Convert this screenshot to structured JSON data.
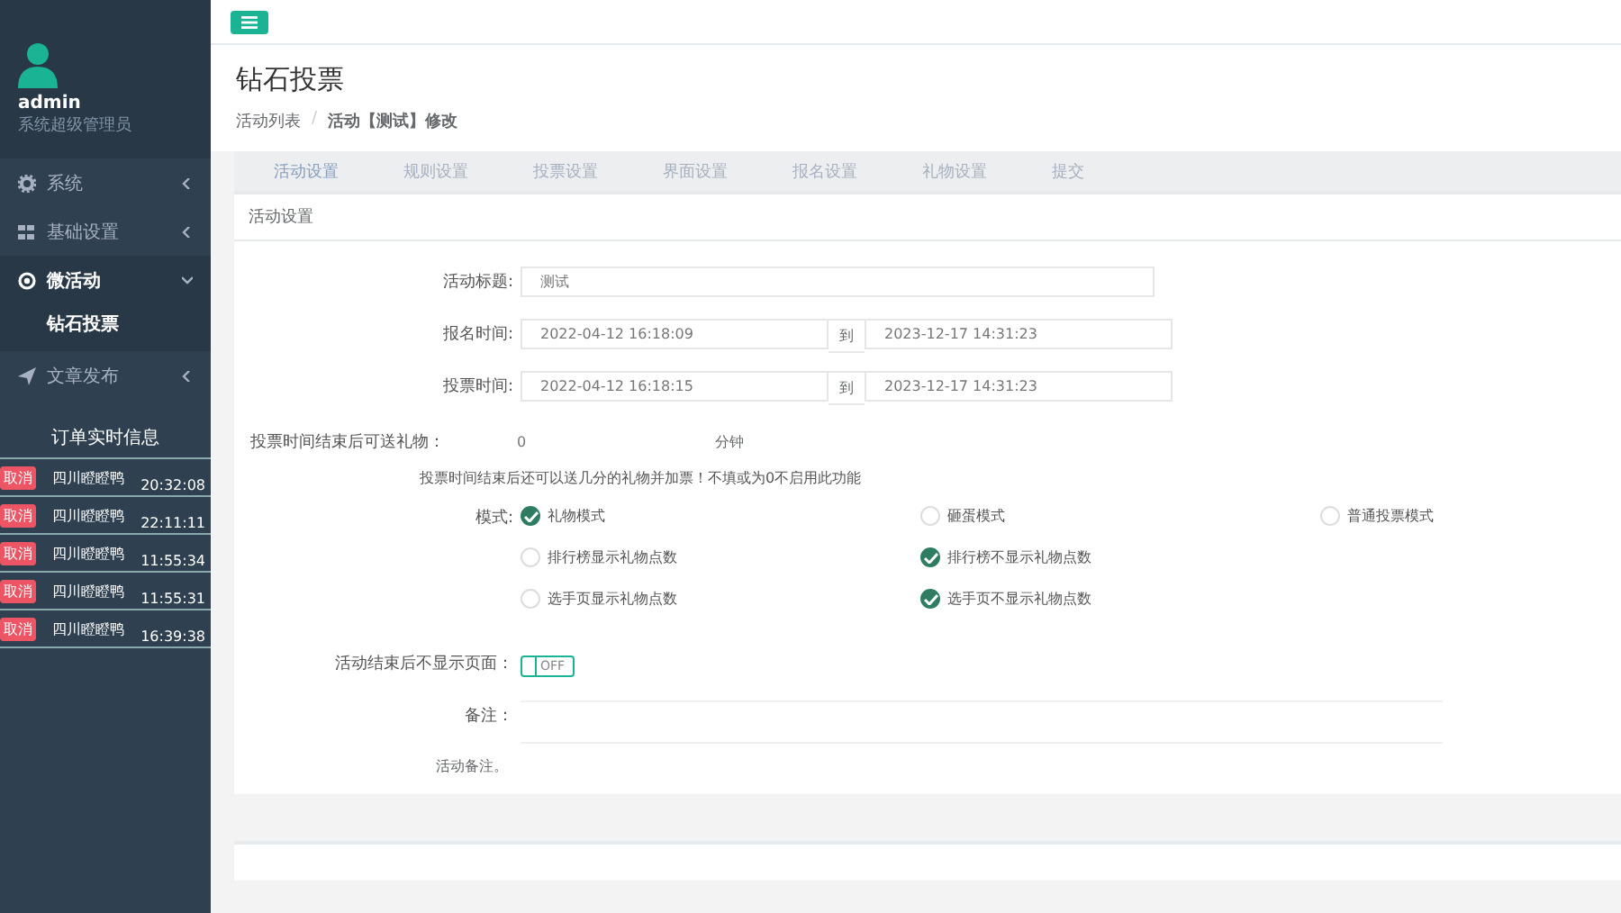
{
  "sidebar": {
    "user": {
      "name": "admin",
      "role": "系统超级管理员"
    },
    "menu": [
      {
        "label": "系统",
        "expanded": false
      },
      {
        "label": "基础设置",
        "expanded": false
      },
      {
        "label": "微活动",
        "expanded": true,
        "children": [
          {
            "label": "钻石投票",
            "selected": true
          }
        ]
      },
      {
        "label": "文章发布",
        "expanded": false
      }
    ],
    "orders": {
      "title": "订单实时信息",
      "rows": [
        {
          "tag": "取消",
          "name": "四川瞪瞪鸭",
          "time": "20:32:08"
        },
        {
          "tag": "取消",
          "name": "四川瞪瞪鸭",
          "time": "22:11:11"
        },
        {
          "tag": "取消",
          "name": "四川瞪瞪鸭",
          "time": "11:55:34"
        },
        {
          "tag": "取消",
          "name": "四川瞪瞪鸭",
          "time": "11:55:31"
        },
        {
          "tag": "取消",
          "name": "四川瞪瞪鸭",
          "time": "16:39:38"
        }
      ]
    }
  },
  "page": {
    "title": "钻石投票",
    "breadcrumb": [
      "活动列表",
      "活动【测试】修改"
    ],
    "breadcrumb_separator": "/"
  },
  "tabs": [
    {
      "label": "活动设置",
      "selected": true
    },
    {
      "label": "规则设置",
      "selected": false
    },
    {
      "label": "投票设置",
      "selected": false
    },
    {
      "label": "界面设置",
      "selected": false
    },
    {
      "label": "报名设置",
      "selected": false
    },
    {
      "label": "礼物设置",
      "selected": false
    },
    {
      "label": "提交",
      "selected": false
    }
  ],
  "panel": {
    "title": "活动设置",
    "title_field": {
      "label": "活动标题:",
      "value": "测试"
    },
    "ranges": [
      {
        "label": "报名时间:",
        "start": "2022-04-12 16:18:09",
        "sep": "到",
        "end": "2023-12-17 14:31:23"
      },
      {
        "label": "投票时间:",
        "start": "2022-04-12 16:18:15",
        "sep": "到",
        "end": "2023-12-17 14:31:23"
      }
    ],
    "gift": {
      "label": "投票时间结束后可送礼物：",
      "value": "0",
      "unit": "分钟",
      "help": "投票时间结束后还可以送几分的礼物并加票！不填或为0不启用此功能"
    },
    "mode": {
      "label": "模式:",
      "rows": [
        [
          {
            "label": "礼物模式",
            "checked": true
          },
          {
            "label": "砸蛋模式",
            "checked": false
          },
          {
            "label": "普通投票模式",
            "checked": false
          }
        ],
        [
          {
            "label": "排行榜显示礼物点数",
            "checked": false
          },
          {
            "label": "排行榜不显示礼物点数",
            "checked": true
          }
        ],
        [
          {
            "label": "选手页显示礼物点数",
            "checked": false
          },
          {
            "label": "选手页不显示礼物点数",
            "checked": true
          }
        ]
      ]
    },
    "hide_switch": {
      "label": "活动结束后不显示页面：",
      "on": false,
      "text": "OFF"
    },
    "note": {
      "label": "备注：",
      "help": "活动备注。"
    }
  }
}
